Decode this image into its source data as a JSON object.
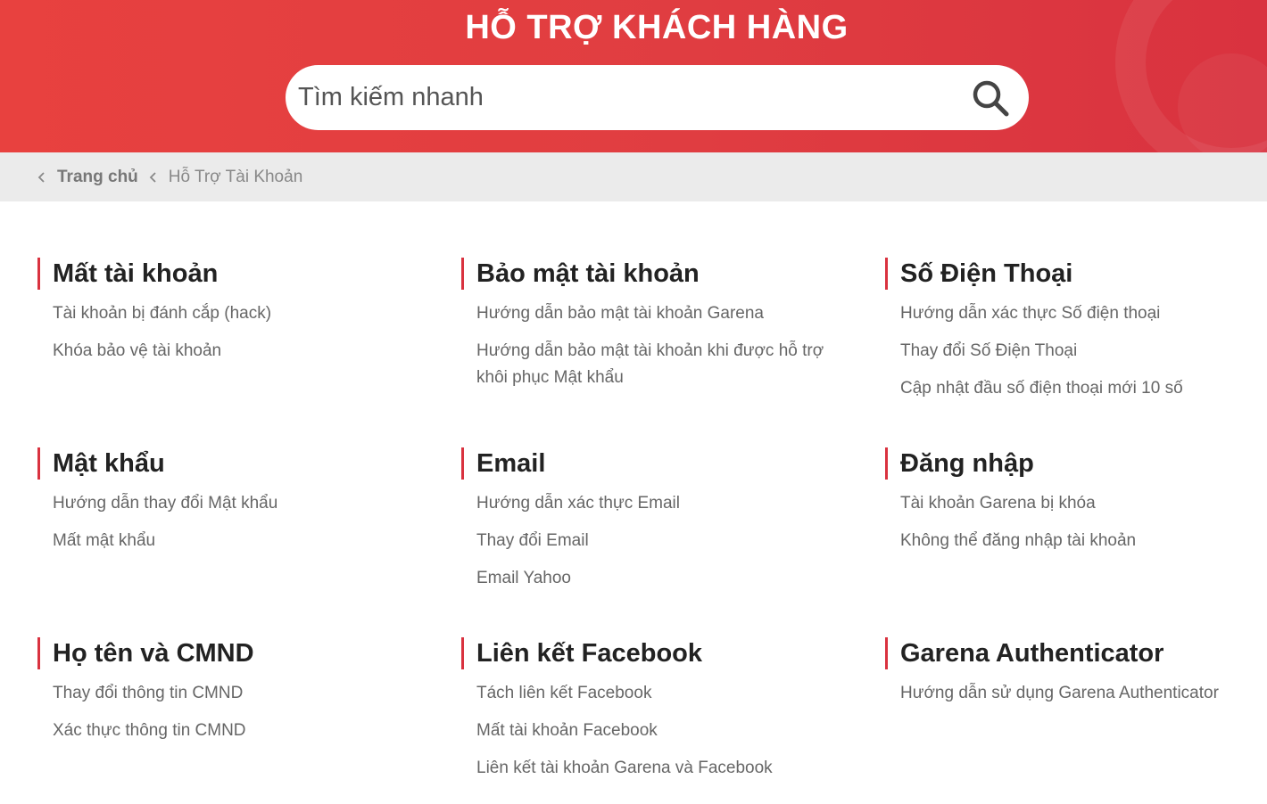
{
  "header": {
    "title": "HỖ TRỢ KHÁCH HÀNG",
    "search_placeholder": "Tìm kiếm nhanh",
    "search_icon": "search-icon",
    "brand_color": "#e03d41"
  },
  "breadcrumb": {
    "home": "Trang chủ",
    "current": "Hỗ Trợ Tài Khoản"
  },
  "categories": [
    {
      "title": "Mất tài khoản",
      "links": [
        "Tài khoản bị đánh cắp (hack)",
        "Khóa bảo vệ tài khoản"
      ]
    },
    {
      "title": "Bảo mật tài khoản",
      "links": [
        "Hướng dẫn bảo mật tài khoản Garena",
        "Hướng dẫn bảo mật tài khoản khi được hỗ trợ khôi phục Mật khẩu"
      ]
    },
    {
      "title": "Số Điện Thoại",
      "links": [
        "Hướng dẫn xác thực Số điện thoại",
        "Thay đổi Số Điện Thoại",
        "Cập nhật đầu số điện thoại mới 10 số"
      ]
    },
    {
      "title": "Mật khẩu",
      "links": [
        "Hướng dẫn thay đổi Mật khẩu",
        "Mất mật khẩu"
      ]
    },
    {
      "title": "Email",
      "links": [
        "Hướng dẫn xác thực Email",
        "Thay đổi Email",
        "Email Yahoo"
      ]
    },
    {
      "title": "Đăng nhập",
      "links": [
        "Tài khoản Garena bị khóa",
        "Không thể đăng nhập tài khoản"
      ]
    },
    {
      "title": "Họ tên và CMND",
      "links": [
        "Thay đổi thông tin CMND",
        "Xác thực thông tin CMND"
      ]
    },
    {
      "title": "Liên kết Facebook",
      "links": [
        "Tách liên kết Facebook",
        "Mất tài khoản Facebook",
        "Liên kết tài khoản Garena và Facebook"
      ]
    },
    {
      "title": "Garena Authenticator",
      "links": [
        "Hướng dẫn sử dụng Garena Authenticator"
      ]
    }
  ]
}
